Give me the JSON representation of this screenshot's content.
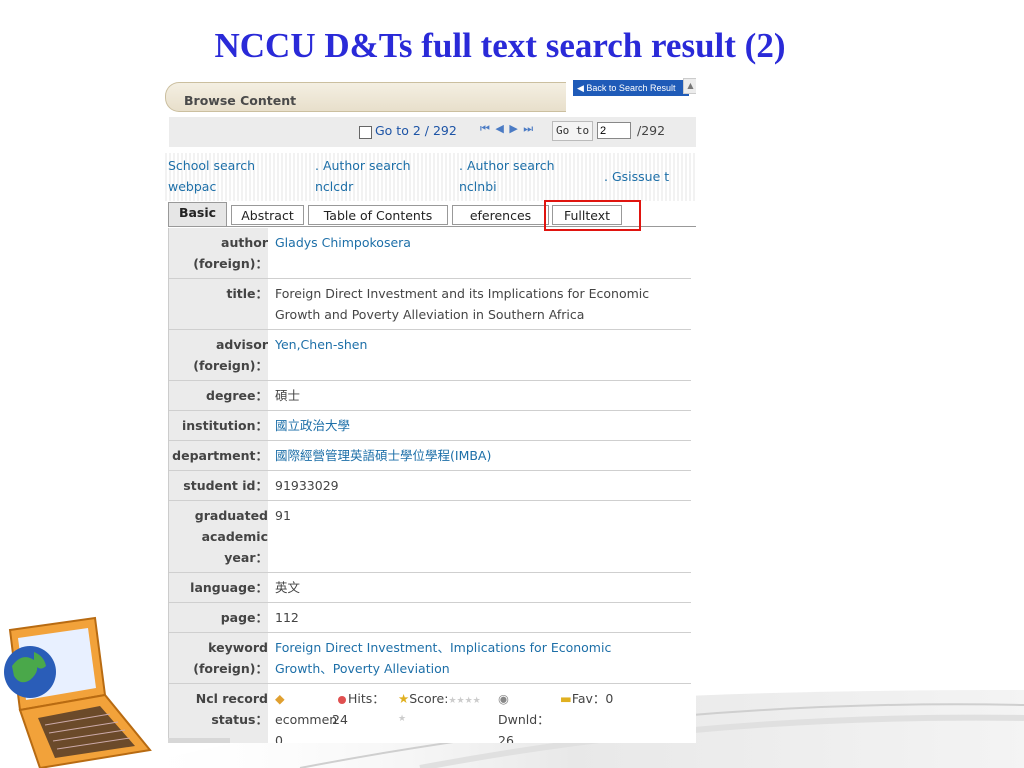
{
  "slide_title": "NCCU D&Ts full text search result (2)",
  "browse": {
    "header": "Browse Content",
    "back_label": "◀ Back to Search Result"
  },
  "nav": {
    "goto_text": "Go to 2 / 292",
    "arrows": "⏮ ◀ ▶ ⏭",
    "goto_button": "Go to",
    "goto_value": "2",
    "total": "/292"
  },
  "links": [
    {
      "line1": "School search",
      "line2": "webpac"
    },
    {
      "line1": ". Author search",
      "line2": "nclcdr"
    },
    {
      "line1": ". Author search",
      "line2": "nclnbi"
    },
    {
      "line1": ". Gsissue t",
      "line2": ""
    }
  ],
  "tabs": {
    "basic": "Basic",
    "abstract": "Abstract",
    "toc": "Table of Contents",
    "references": "eferences",
    "fulltext": "Fulltext"
  },
  "records": [
    {
      "label": "author\n(foreign)：",
      "value": "Gladys Chimpokosera",
      "link": true
    },
    {
      "label": "title：",
      "value": "Foreign Direct Investment and its Implications for Economic\nGrowth and Poverty Alleviation in Southern Africa",
      "link": false
    },
    {
      "label": "advisor\n(foreign)：",
      "value": "Yen,Chen-shen",
      "link": true
    },
    {
      "label": "degree：",
      "value": "碩士",
      "link": false
    },
    {
      "label": "institution：",
      "value": "國立政治大學",
      "link": true
    },
    {
      "label": "department：",
      "value": "國際經營管理英語碩士學位學程(IMBA)",
      "link": true
    },
    {
      "label": "student id：",
      "value": "91933029",
      "link": false
    },
    {
      "label": "graduated\nacademic\nyear：",
      "value": "91",
      "link": false
    },
    {
      "label": "language：",
      "value": "英文",
      "link": false
    },
    {
      "label": "page：",
      "value": "112",
      "link": false
    },
    {
      "label": "keyword\n(foreign)：",
      "value": "Foreign Direct Investment、Implications for Economic\nGrowth、Poverty Alleviation",
      "link": true
    }
  ],
  "status_row": {
    "label": "Ncl record\nstatus：",
    "recommend": "ecommen",
    "recommend_count": "0",
    "hits_label": "Hits：",
    "hits_value": "24",
    "score_label": "Score:",
    "download_label": "Dwnld：",
    "download_value": "26",
    "fav_label": "Fav：0"
  },
  "colors": {
    "title": "#2a2ad8",
    "link": "#1d6fa8",
    "highlight_box": "#e0140f",
    "back_button": "#1f5bb8"
  }
}
